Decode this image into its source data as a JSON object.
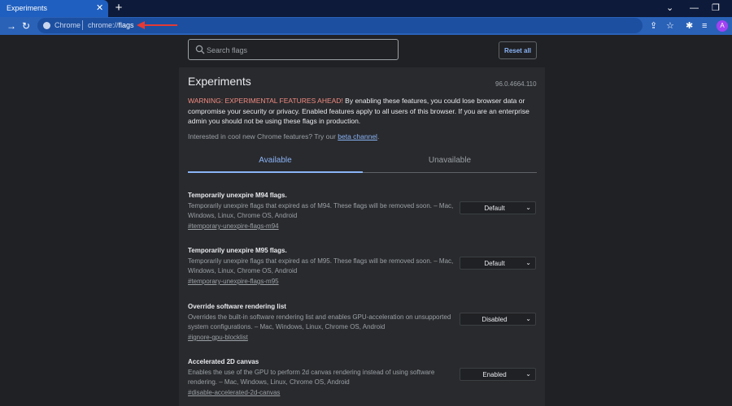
{
  "tab": {
    "title": "Experiments",
    "close": "✕",
    "new_tab": "+"
  },
  "window": {
    "chevron": "⌄",
    "minimize": "—",
    "restore": "❐"
  },
  "toolbar": {
    "forward": "→",
    "reload": "↻",
    "site_chip": "Chrome",
    "url_host": "chrome://",
    "url_path": "flags",
    "share_icon": "⇪",
    "star_icon": "☆",
    "extensions_icon": "✱",
    "media_icon": "≡",
    "avatar_letter": "A"
  },
  "search": {
    "placeholder": "Search flags"
  },
  "reset_label": "Reset all",
  "page": {
    "title": "Experiments",
    "version": "96.0.4664.110",
    "warning_red": "WARNING: EXPERIMENTAL FEATURES AHEAD!",
    "warning_rest": " By enabling these features, you could lose browser data or compromise your security or privacy. Enabled features apply to all users of this browser. If you are an enterprise admin you should not be using these flags in production.",
    "interest_text": "Interested in cool new Chrome features? Try our ",
    "interest_link": "beta channel",
    "interest_end": ".",
    "tab_available": "Available",
    "tab_unavailable": "Unavailable"
  },
  "experiments": [
    {
      "title": "Temporarily unexpire M94 flags.",
      "desc": "Temporarily unexpire flags that expired as of M94. These flags will be removed soon. – Mac, Windows, Linux, Chrome OS, Android",
      "link": "#temporary-unexpire-flags-m94",
      "value": "Default"
    },
    {
      "title": "Temporarily unexpire M95 flags.",
      "desc": "Temporarily unexpire flags that expired as of M95. These flags will be removed soon. – Mac, Windows, Linux, Chrome OS, Android",
      "link": "#temporary-unexpire-flags-m95",
      "value": "Default"
    },
    {
      "title": "Override software rendering list",
      "desc": "Overrides the built-in software rendering list and enables GPU-acceleration on unsupported system configurations. – Mac, Windows, Linux, Chrome OS, Android",
      "link": "#ignore-gpu-blocklist",
      "value": "Disabled"
    },
    {
      "title": "Accelerated 2D canvas",
      "desc": "Enables the use of the GPU to perform 2d canvas rendering instead of using software rendering. – Mac, Windows, Linux, Chrome OS, Android",
      "link": "#disable-accelerated-2d-canvas",
      "value": "Enabled"
    }
  ],
  "colors": {
    "accent": "#8ab4f8",
    "warning": "#f28b82",
    "titlebar": "#2a62b8",
    "annotation_arrow": "#e53935"
  }
}
